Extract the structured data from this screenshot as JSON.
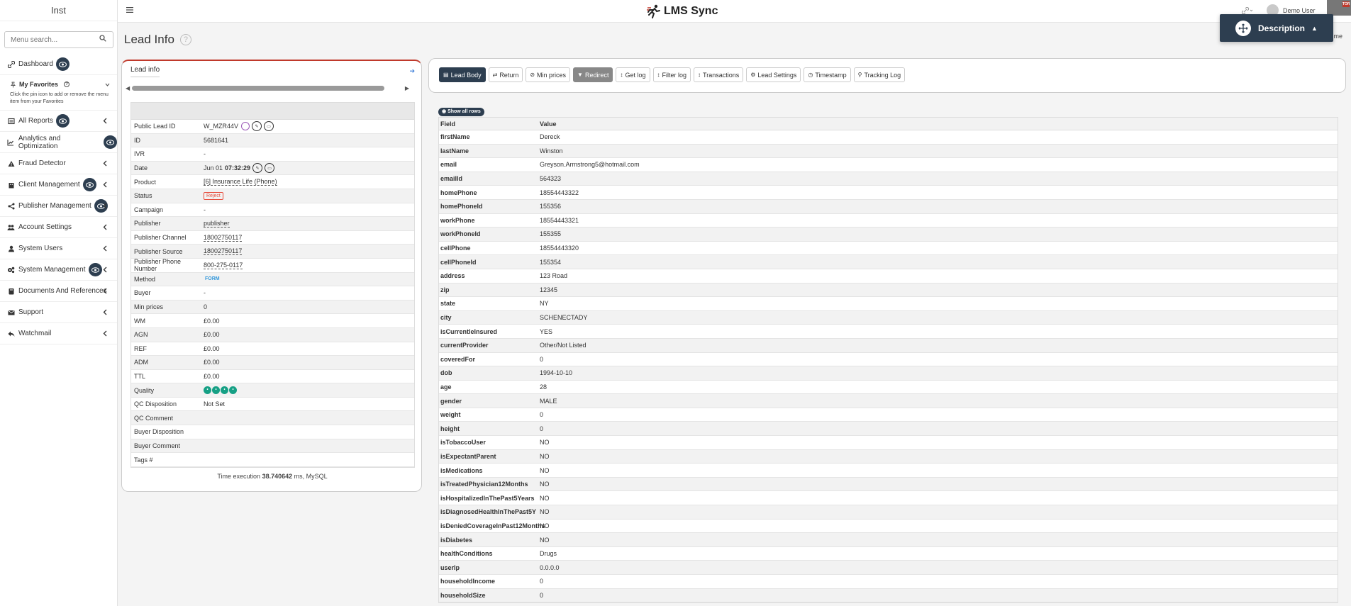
{
  "sidebar": {
    "brand": "Inst",
    "search_placeholder": "Menu search...",
    "favorites": {
      "title": "My Favorites",
      "note": "Click the pin icon to add or remove the menu item from your Favorites"
    },
    "items": [
      {
        "label": "Dashboard"
      },
      {
        "label": "All Reports"
      },
      {
        "label": "Analytics and Optimization"
      },
      {
        "label": "Fraud Detector"
      },
      {
        "label": "Client Management"
      },
      {
        "label": "Publisher Management"
      },
      {
        "label": "Account Settings"
      },
      {
        "label": "System Users"
      },
      {
        "label": "System Management"
      },
      {
        "label": "Documents And References"
      },
      {
        "label": "Support"
      },
      {
        "label": "Watchmail"
      }
    ]
  },
  "topbar": {
    "app_name": "LMS Sync",
    "user_name": "Demo User",
    "corner_badge": "TOR",
    "home_label": "me"
  },
  "description_pill": {
    "label": "Description"
  },
  "page": {
    "title": "Lead Info"
  },
  "lead_info": {
    "heading": "Lead info",
    "rows": [
      {
        "field": "Public Lead ID",
        "value": "W_MZR44V"
      },
      {
        "field": "ID",
        "value": "5681641"
      },
      {
        "field": "IVR",
        "value": "-"
      },
      {
        "field": "Date",
        "value": "Jun 01",
        "time": "07:32:29"
      },
      {
        "field": "Product",
        "value": "[6] Insurance Life (Phone)"
      },
      {
        "field": "Status",
        "value": "Reject"
      },
      {
        "field": "Campaign",
        "value": "-"
      },
      {
        "field": "Publisher",
        "value": "publisher"
      },
      {
        "field": "Publisher Channel",
        "value": "18002750117"
      },
      {
        "field": "Publisher Source",
        "value": "18002750117"
      },
      {
        "field": "Publisher Phone Number",
        "value": "800-275-0117"
      },
      {
        "field": "Method",
        "value": "FORM"
      },
      {
        "field": "Buyer",
        "value": "-"
      },
      {
        "field": "Min prices",
        "value": "0"
      },
      {
        "field": "WM",
        "value": "£0.00"
      },
      {
        "field": "AGN",
        "value": "£0.00"
      },
      {
        "field": "REF",
        "value": "£0.00"
      },
      {
        "field": "ADM",
        "value": "£0.00"
      },
      {
        "field": "TTL",
        "value": "£0.00"
      },
      {
        "field": "Quality",
        "value": ""
      },
      {
        "field": "QC Disposition",
        "value": "Not Set"
      },
      {
        "field": "QC Comment",
        "value": ""
      },
      {
        "field": "Buyer Disposition",
        "value": ""
      },
      {
        "field": "Buyer Comment",
        "value": ""
      },
      {
        "field": "Tags #",
        "value": ""
      }
    ],
    "time_exec_prefix": "Time execution",
    "time_exec_value": "38.740642",
    "time_exec_suffix": "ms, MySQL"
  },
  "tabs": [
    {
      "label": "Lead Body",
      "icon": "file-icon"
    },
    {
      "label": "Return",
      "icon": "swap-icon"
    },
    {
      "label": "Min prices",
      "icon": "ban-icon"
    },
    {
      "label": "Redirect",
      "icon": "filter-icon"
    },
    {
      "label": "Get log",
      "icon": "sort-icon"
    },
    {
      "label": "Filter log",
      "icon": "sort-icon"
    },
    {
      "label": "Transactions",
      "icon": "sort-icon"
    },
    {
      "label": "Lead Settings",
      "icon": "gear-icon"
    },
    {
      "label": "Timestamp",
      "icon": "clock-icon"
    },
    {
      "label": "Tracking Log",
      "icon": "link-icon"
    }
  ],
  "lead_body": {
    "show_all_label": "Show all rows",
    "header_field": "Field",
    "header_value": "Value",
    "rows": [
      {
        "field": "firstName",
        "value": "Dereck"
      },
      {
        "field": "lastName",
        "value": "Winston"
      },
      {
        "field": "email",
        "value": "Greyson.Armstrong5@hotmail.com"
      },
      {
        "field": "emailId",
        "value": "564323"
      },
      {
        "field": "homePhone",
        "value": "18554443322"
      },
      {
        "field": "homePhoneId",
        "value": "155356"
      },
      {
        "field": "workPhone",
        "value": "18554443321"
      },
      {
        "field": "workPhoneId",
        "value": "155355"
      },
      {
        "field": "cellPhone",
        "value": "18554443320"
      },
      {
        "field": "cellPhoneId",
        "value": "155354"
      },
      {
        "field": "address",
        "value": "123 Road"
      },
      {
        "field": "zip",
        "value": "12345"
      },
      {
        "field": "state",
        "value": "NY"
      },
      {
        "field": "city",
        "value": "SCHENECTADY"
      },
      {
        "field": "isCurrentleInsured",
        "value": "YES"
      },
      {
        "field": "currentProvider",
        "value": "Other/Not Listed"
      },
      {
        "field": "coveredFor",
        "value": "0"
      },
      {
        "field": "dob",
        "value": "1994-10-10"
      },
      {
        "field": "age",
        "value": "28"
      },
      {
        "field": "gender",
        "value": "MALE"
      },
      {
        "field": "weight",
        "value": "0"
      },
      {
        "field": "height",
        "value": "0"
      },
      {
        "field": "isTobaccoUser",
        "value": "NO"
      },
      {
        "field": "isExpectantParent",
        "value": "NO"
      },
      {
        "field": "isMedications",
        "value": "NO"
      },
      {
        "field": "isTreatedPhysician12Months",
        "value": "NO"
      },
      {
        "field": "isHospitalizedInThePast5Years",
        "value": "NO"
      },
      {
        "field": "isDiagnosedHealthInThePast5Y",
        "value": "NO"
      },
      {
        "field": "isDeniedCoverageInPast12Months",
        "value": "NO"
      },
      {
        "field": "isDiabetes",
        "value": "NO"
      },
      {
        "field": "healthConditions",
        "value": "Drugs"
      },
      {
        "field": "userIp",
        "value": "0.0.0.0"
      },
      {
        "field": "householdIncome",
        "value": "0"
      },
      {
        "field": "householdSize",
        "value": "0"
      }
    ]
  }
}
